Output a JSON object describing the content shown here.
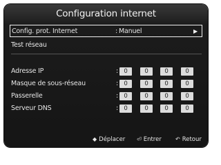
{
  "title": "Configuration internet",
  "config_row": {
    "label": "Config. prot. Internet",
    "colon": ":",
    "value": "Manuel",
    "arrow": "▶"
  },
  "test_row": {
    "label": "Test réseau"
  },
  "ip_fields": [
    {
      "label": "Adresse IP",
      "colon": ":",
      "octets": [
        "0",
        "0",
        "0",
        "0"
      ]
    },
    {
      "label": "Masque de sous-réseau",
      "colon": ":",
      "octets": [
        "0",
        "0",
        "0",
        "0"
      ]
    },
    {
      "label": "Passerelle",
      "colon": ":",
      "octets": [
        "0",
        "0",
        "0",
        "0"
      ]
    },
    {
      "label": "Serveur DNS",
      "colon": ":",
      "octets": [
        "0",
        "0",
        "0",
        "0"
      ]
    }
  ],
  "footer": {
    "move": {
      "icon": "up-down-icon",
      "glyph": "◆",
      "label": "Déplacer"
    },
    "enter": {
      "icon": "enter-icon",
      "glyph": "⏎",
      "label": "Entrer"
    },
    "back": {
      "icon": "return-icon",
      "glyph": "↶",
      "label": "Retour"
    }
  }
}
